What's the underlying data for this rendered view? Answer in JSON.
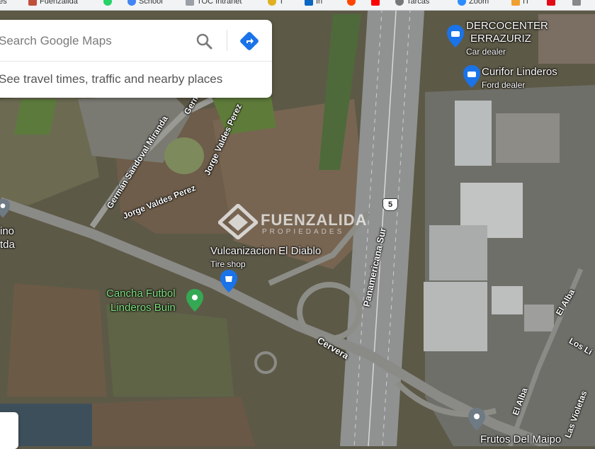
{
  "bookmarks_bar": {
    "items": [
      {
        "label": "nes",
        "icon": "bookmark-folder-icon",
        "color": "#888888"
      },
      {
        "label": "Fuenzalida",
        "icon": "fuenzalida-favicon",
        "color": "#c0503a"
      },
      {
        "label": "",
        "icon": "whatsapp-icon",
        "color": "#25d366"
      },
      {
        "label": "School",
        "icon": "school-favicon",
        "color": "#4285f4"
      },
      {
        "label": "TOC Intranet",
        "icon": "page-icon",
        "color": "#9aa0a6"
      },
      {
        "label": "T",
        "icon": "marker-favicon",
        "color": "#e0b020"
      },
      {
        "label": "In",
        "icon": "linkedin-icon",
        "color": "#0a66c2"
      },
      {
        "label": "",
        "icon": "reddit-icon",
        "color": "#ff4500"
      },
      {
        "label": "",
        "icon": "youtube-icon",
        "color": "#ff0000"
      },
      {
        "label": "Tarcas",
        "icon": "gear-favicon",
        "color": "#777777"
      },
      {
        "label": "Zoom",
        "icon": "zoom-favicon",
        "color": "#2d8cff"
      },
      {
        "label": "IT",
        "icon": "tag-favicon",
        "color": "#f0a030"
      },
      {
        "label": "",
        "icon": "netflix-icon",
        "color": "#e50914"
      },
      {
        "label": "",
        "icon": "bookmark-icon",
        "color": "#888888"
      }
    ]
  },
  "search": {
    "placeholder": "Search Google Maps",
    "search_icon": "search-icon",
    "directions_icon": "directions-icon",
    "hint": "See travel times, traffic and nearby places"
  },
  "pois": {
    "dercocenter": {
      "name_line1": "DERCOCENTER",
      "name_line2": "ERRAZURIZ",
      "category": "Car dealer"
    },
    "curifor": {
      "name": "Curifor Linderos",
      "category": "Ford dealer"
    },
    "vulcanizacion": {
      "name": "Vulcanizacion El Diablo",
      "category": "Tire shop"
    },
    "cancha": {
      "name_line1": "Cancha Futbol",
      "name_line2": "Linderos Buin"
    },
    "frutos": {
      "name": "Frutos Del Maipo"
    },
    "left_place": {
      "line1": "ino",
      "line2": "tda"
    }
  },
  "streets": {
    "german_sandoval": "Germán Sandoval Miranda",
    "german_short": "Germ",
    "jorge_valdes_1": "Jorge Valdes Perez",
    "jorge_valdes_2": "Jorge Valdes Perez",
    "panamericana": "Panamericana Sur",
    "cervera": "Cervera",
    "el_alba_1": "El Alba",
    "el_alba_2": "El Alba",
    "los_li": "Los Li",
    "las_violetas": "Las Violetas"
  },
  "highway_shield": "5",
  "watermark": {
    "name": "FUENZALIDA",
    "sub": "PROPIEDADES"
  },
  "colors": {
    "pin_blue": "#1a73e8",
    "pin_green": "#34a853",
    "pin_gray": "#6e7a84",
    "poi_green_text": "#7fe07f"
  }
}
